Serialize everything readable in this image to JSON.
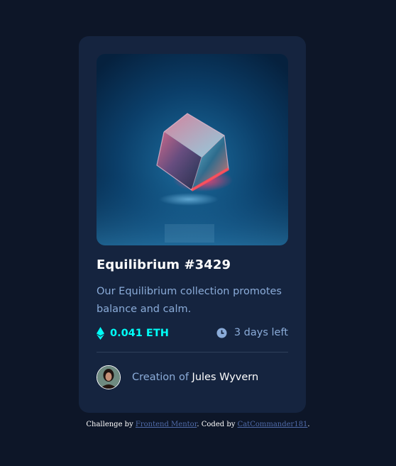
{
  "card": {
    "title": "Equilibrium #3429",
    "description": "Our Equilibrium collection promotes balance and calm.",
    "price": "0.041 ETH",
    "time_left": "3 days left",
    "creator_prefix": "Creation of",
    "creator_name": "Jules Wyvern"
  },
  "icons": {
    "price": "ethereum-icon",
    "time": "clock-icon"
  },
  "attribution": {
    "prefix": "Challenge by",
    "link1": "Frontend Mentor",
    "middle": ". Coded by",
    "link2": "CatCommander181",
    "suffix": "."
  },
  "colors": {
    "background": "#0d1628",
    "card": "#15243f",
    "accent_cyan": "#00fff8",
    "soft_blue": "#8bacd9",
    "white": "#ffffff",
    "divider": "#2e405a"
  }
}
